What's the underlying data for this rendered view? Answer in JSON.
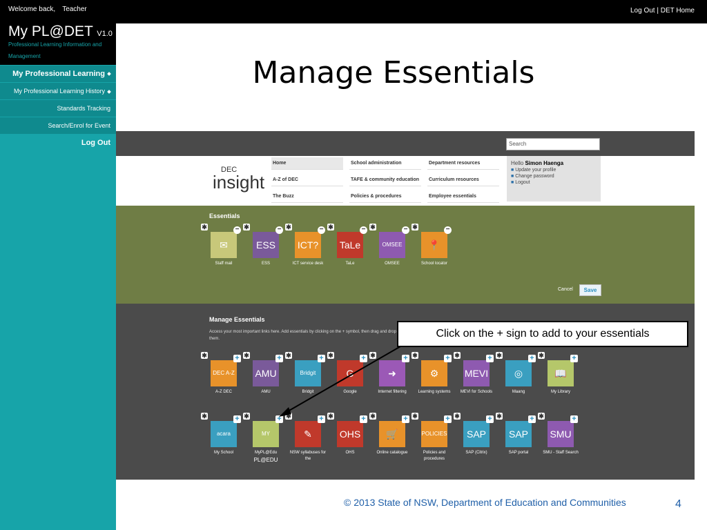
{
  "topbar": {
    "welcome": "Welcome back,",
    "user": "Teacher",
    "links": "Log Out | DET Home"
  },
  "app": {
    "title": "My PL@DET",
    "version": "V1.0",
    "subtitle": "Professional Learning Information and Management"
  },
  "sidebar": {
    "items": [
      {
        "label": "My Professional Learning"
      },
      {
        "label": "My Professional Learning History"
      },
      {
        "label": "Standards Tracking"
      },
      {
        "label": "Search/Enrol for Event"
      },
      {
        "label": "Log Out"
      }
    ]
  },
  "slide": {
    "title": "Manage Essentials",
    "footer": "© 2013 State of NSW, Department of Education and Communities",
    "page": "4"
  },
  "callout": "Click on the + sign to add to your essentials",
  "portal": {
    "search_placeholder": "Search",
    "brand_small": "DEC",
    "brand": "insight",
    "menu": [
      [
        "Home",
        "A-Z of DEC",
        "The Buzz"
      ],
      [
        "School administration",
        "TAFE & community education",
        "Policies & procedures"
      ],
      [
        "Department resources",
        "Curriculum resources",
        "Employee essentials"
      ]
    ],
    "hello": "Hello",
    "user": "Simon Haenga",
    "user_links": [
      "Update your profile",
      "Change password",
      "Logout"
    ],
    "essentials_title": "Essentials",
    "essentials": [
      {
        "label": "Staff mail",
        "glyph": "✉",
        "color": "#c8c87a"
      },
      {
        "label": "ESS",
        "glyph": "ESS",
        "color": "#7a5a9a"
      },
      {
        "label": "ICT service desk",
        "glyph": "ICT?",
        "color": "#e8922a"
      },
      {
        "label": "TaLe",
        "glyph": "TaLe",
        "color": "#c0392b"
      },
      {
        "label": "OMSEE",
        "glyph": "OMSEE",
        "color": "#8e5ab0"
      },
      {
        "label": "School locator",
        "glyph": "📍",
        "color": "#e8922a"
      }
    ],
    "cancel": "Cancel",
    "save": "Save",
    "manage_title": "Manage Essentials",
    "manage_desc": "Access your most important links here. Add essentials by clicking on the + symbol, then drag and drop the icons to re-arrange them.",
    "row1": [
      {
        "label": "A-Z DEC",
        "glyph": "DEC A-Z",
        "color": "#e8922a"
      },
      {
        "label": "AMU",
        "glyph": "AMU",
        "color": "#7a5a9a"
      },
      {
        "label": "Bridgit",
        "glyph": "Bridgit",
        "color": "#3a9fc0"
      },
      {
        "label": "Google",
        "glyph": "G",
        "color": "#c0392b"
      },
      {
        "label": "Internet filtering",
        "glyph": "➜",
        "color": "#9b59b6"
      },
      {
        "label": "Learning systems",
        "glyph": "⚙",
        "color": "#e8922a"
      },
      {
        "label": "MEVI for Schools",
        "glyph": "MEVI",
        "color": "#8e5ab0"
      },
      {
        "label": "Maang",
        "glyph": "◎",
        "color": "#3a9fc0"
      },
      {
        "label": "My Library",
        "glyph": "📖",
        "color": "#b5c76a"
      }
    ],
    "row2": [
      {
        "label": "My School",
        "glyph": "acara",
        "color": "#3a9fc0"
      },
      {
        "label": "MyPL@Edu",
        "glyph": "MY PL@EDU",
        "color": "#b5c76a"
      },
      {
        "label": "NSW syllabuses for the",
        "glyph": "✎",
        "color": "#c0392b"
      },
      {
        "label": "OHS",
        "glyph": "OHS",
        "color": "#c0392b"
      },
      {
        "label": "Online catalogue",
        "glyph": "🛒",
        "color": "#e8922a"
      },
      {
        "label": "Policies and procedures",
        "glyph": "POLICIES",
        "color": "#e8922a"
      },
      {
        "label": "SAP (Citrix)",
        "glyph": "SAP",
        "color": "#3a9fc0"
      },
      {
        "label": "SAP portal",
        "glyph": "SAP",
        "color": "#3a9fc0"
      },
      {
        "label": "SMU - Staff Search",
        "glyph": "SMU",
        "color": "#8e5ab0"
      }
    ]
  }
}
